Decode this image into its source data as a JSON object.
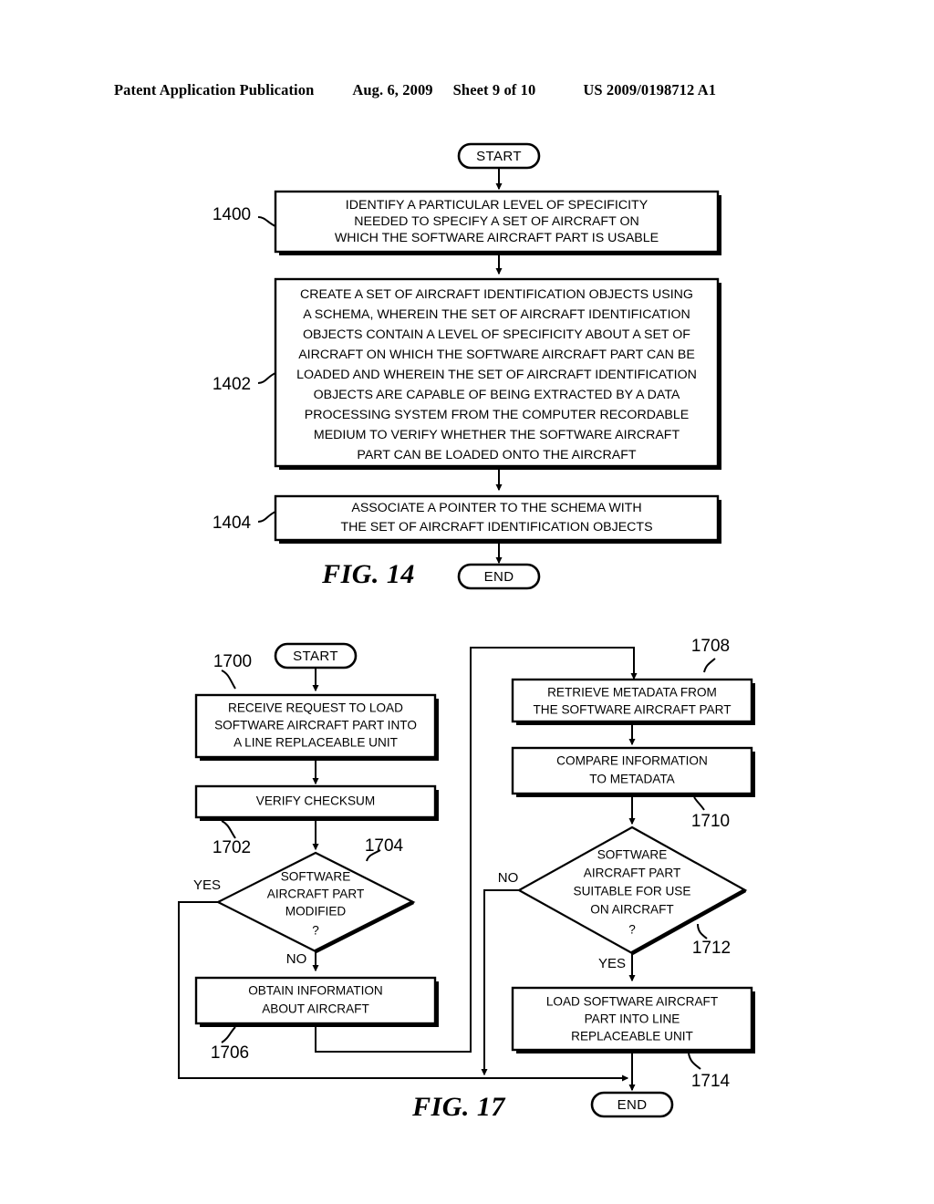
{
  "header": {
    "publication": "Patent Application Publication",
    "date": "Aug. 6, 2009",
    "sheet": "Sheet 9 of 10",
    "patent_number": "US 2009/0198712 A1"
  },
  "figures": [
    {
      "id": "fig14",
      "label": "FIG. 14",
      "terminals": {
        "start": "START",
        "end": "END"
      },
      "steps": [
        {
          "ref": "1400",
          "lines": [
            "IDENTIFY A PARTICULAR LEVEL OF SPECIFICITY",
            "NEEDED TO SPECIFY A SET OF AIRCRAFT ON",
            "WHICH THE SOFTWARE AIRCRAFT PART IS USABLE"
          ]
        },
        {
          "ref": "1402",
          "lines": [
            "CREATE A SET OF AIRCRAFT IDENTIFICATION OBJECTS USING",
            "A SCHEMA, WHEREIN THE SET OF AIRCRAFT IDENTIFICATION",
            "OBJECTS CONTAIN A LEVEL OF SPECIFICITY ABOUT A SET OF",
            "AIRCRAFT ON WHICH THE SOFTWARE AIRCRAFT PART CAN BE",
            "LOADED AND WHEREIN THE SET OF AIRCRAFT IDENTIFICATION",
            "OBJECTS ARE CAPABLE OF BEING EXTRACTED BY A DATA",
            "PROCESSING SYSTEM FROM THE COMPUTER RECORDABLE",
            "MEDIUM TO VERIFY WHETHER THE SOFTWARE AIRCRAFT",
            "PART CAN BE LOADED ONTO THE AIRCRAFT"
          ]
        },
        {
          "ref": "1404",
          "lines": [
            "ASSOCIATE A POINTER TO THE SCHEMA WITH",
            "THE SET OF AIRCRAFT IDENTIFICATION OBJECTS"
          ]
        }
      ]
    },
    {
      "id": "fig17",
      "label": "FIG. 17",
      "terminals": {
        "start": "START",
        "end": "END"
      },
      "steps": [
        {
          "ref": "1700",
          "kind": "process",
          "lines": [
            "RECEIVE REQUEST TO LOAD",
            "SOFTWARE AIRCRAFT PART INTO",
            "A LINE REPLACEABLE UNIT"
          ]
        },
        {
          "ref": "1702",
          "kind": "process",
          "lines": [
            "VERIFY CHECKSUM"
          ]
        },
        {
          "ref": "1704",
          "kind": "decision",
          "lines": [
            "SOFTWARE",
            "AIRCRAFT PART",
            "MODIFIED",
            "?"
          ],
          "branches": {
            "left": "YES",
            "bottom": "NO"
          }
        },
        {
          "ref": "1706",
          "kind": "process",
          "lines": [
            "OBTAIN INFORMATION",
            "ABOUT AIRCRAFT"
          ]
        },
        {
          "ref": "1708",
          "kind": "process",
          "lines": [
            "RETRIEVE METADATA FROM",
            "THE SOFTWARE AIRCRAFT PART"
          ]
        },
        {
          "ref": "1710",
          "kind": "process",
          "lines": [
            "COMPARE INFORMATION",
            "TO METADATA"
          ]
        },
        {
          "ref": "1712",
          "kind": "decision",
          "lines": [
            "SOFTWARE",
            "AIRCRAFT PART",
            "SUITABLE FOR USE",
            "ON AIRCRAFT",
            "?"
          ],
          "branches": {
            "left": "NO",
            "bottom": "YES"
          }
        },
        {
          "ref": "1714",
          "kind": "process",
          "lines": [
            "LOAD SOFTWARE AIRCRAFT",
            "PART INTO LINE",
            "REPLACEABLE UNIT"
          ]
        }
      ]
    }
  ]
}
